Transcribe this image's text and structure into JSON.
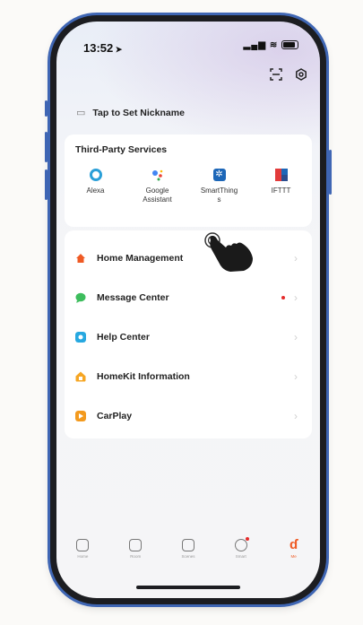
{
  "status_bar": {
    "time": "13:52",
    "signal": "▂▄▆",
    "wifi": "≋"
  },
  "profile": {
    "nickname_prompt": "Tap to Set Nickname"
  },
  "third_party": {
    "title": "Third-Party Services",
    "services": [
      {
        "label": "Alexa",
        "color": "#2a9fd8"
      },
      {
        "label": "Google\nAssistant",
        "color": "#4285f4"
      },
      {
        "label": "SmartThing\ns",
        "color": "#1d67b8"
      },
      {
        "label": "IFTTT",
        "color": "#e23b3b"
      }
    ]
  },
  "menu": {
    "items": [
      {
        "label": "Home Management",
        "color": "#ef5a24"
      },
      {
        "label": "Message Center",
        "color": "#3dbd5d"
      },
      {
        "label": "Help Center",
        "color": "#27a8e0"
      },
      {
        "label": "HomeKit Information",
        "color": "#f6a623"
      },
      {
        "label": "CarPlay",
        "color": "#f39a1e"
      }
    ]
  },
  "tab_bar": {
    "tabs": [
      {
        "label": "Home"
      },
      {
        "label": "Room"
      },
      {
        "label": "Scenes"
      },
      {
        "label": "Smart"
      },
      {
        "label": "Me"
      }
    ]
  },
  "colors": {
    "accent": "#ef5a24",
    "frame": "#3f66b4",
    "notification_dot": "#e52b2b"
  }
}
